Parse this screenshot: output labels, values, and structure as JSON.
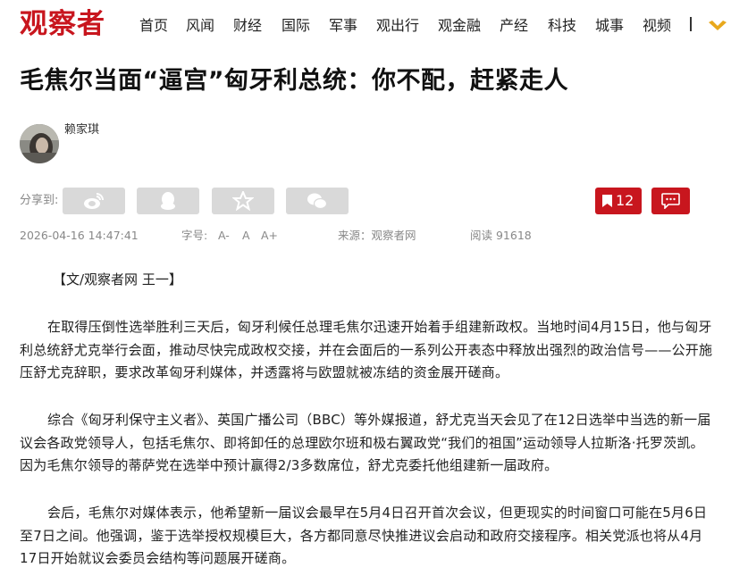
{
  "site": {
    "logo": "观察者"
  },
  "nav": {
    "items": [
      "首页",
      "风闻",
      "财经",
      "国际",
      "军事",
      "观出行",
      "观金融",
      "产经",
      "科技",
      "城事",
      "视频"
    ]
  },
  "article": {
    "title": "毛焦尔当面“逼宫”匈牙利总统：你不配，赶紧走人",
    "author": "赖家琪",
    "share_label": "分享到:",
    "bookmark_count": "12",
    "date": "2026-04-16 14:47:41",
    "font_label": "字号:",
    "font_smaller": "A-",
    "font_normal": "A",
    "font_larger": "A+",
    "source": "来源：观察者网",
    "reads": "阅读 91618",
    "byline": "【文/观察者网 王一】",
    "paragraphs": [
      "在取得压倒性选举胜利三天后，匈牙利候任总理毛焦尔迅速开始着手组建新政权。当地时间4月15日，他与匈牙利总统舒尤克举行会面，推动尽快完成政权交接，并在会面后的一系列公开表态中释放出强烈的政治信号——公开施压舒尤克辞职，要求改革匈牙利媒体，并透露将与欧盟就被冻结的资金展开磋商。",
      "综合《匈牙利保守主义者》、英国广播公司（BBC）等外媒报道，舒尤克当天会见了在12日选举中当选的新一届议会各政党领导人，包括毛焦尔、即将卸任的总理欧尔班和极右翼政党“我们的祖国”运动领导人拉斯洛·托罗茨凯。因为毛焦尔领导的蒂萨党在选举中预计赢得2/3多数席位，舒尤克委托他组建新一届政府。",
      "会后，毛焦尔对媒体表示，他希望新一届议会最早在5月4日召开首次会议，但更现实的时间窗口可能在5月6日至7日之间。他强调，鉴于选举授权规模巨大，各方都同意尽快推进议会启动和政府交接程序。相关党派也将从4月17日开始就议会委员会结构等问题展开磋商。"
    ]
  },
  "colors": {
    "brand_red": "#c8161e",
    "share_gray": "#d9d9d9",
    "meta_gray": "#888888"
  }
}
